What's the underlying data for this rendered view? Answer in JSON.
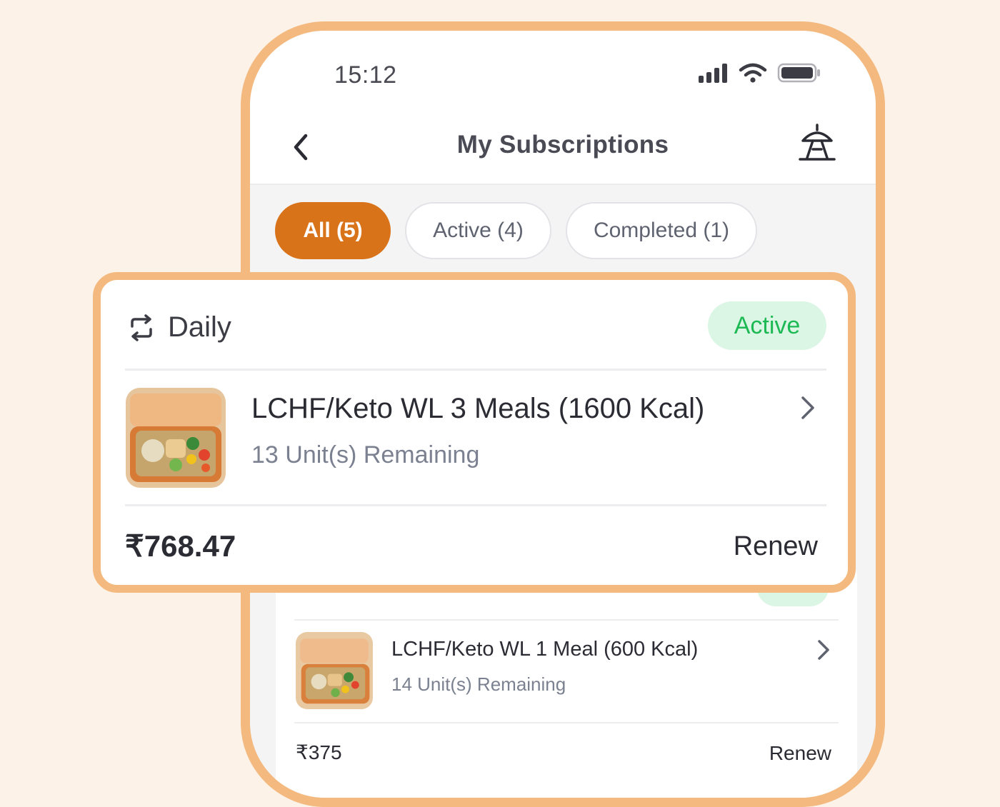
{
  "status_bar": {
    "time": "15:12"
  },
  "header": {
    "title": "My Subscriptions",
    "back_icon": "chevron-left-icon",
    "support_icon": "support-beacon-icon"
  },
  "tabs": [
    {
      "label": "All (5)",
      "selected": true
    },
    {
      "label": "Active (4)",
      "selected": false
    },
    {
      "label": "Completed (1)",
      "selected": false
    }
  ],
  "featured_subscription": {
    "frequency": "Daily",
    "status": "Active",
    "meal_name": "LCHF/Keto WL 3 Meals (1600 Kcal)",
    "units_remaining": "13 Unit(s) Remaining",
    "price": "₹768.47",
    "action": "Renew"
  },
  "subscriptions": [
    {
      "meal_name": "LCHF/Keto WL 1 Meal (600 Kcal)",
      "units_remaining": "14 Unit(s) Remaining",
      "price": "₹375",
      "action": "Renew"
    }
  ],
  "colors": {
    "accent": "#d9731a",
    "frame": "#f3b97f",
    "background": "#fcf2e8",
    "active_badge_bg": "#dcf6e5",
    "active_badge_text": "#1db954"
  }
}
